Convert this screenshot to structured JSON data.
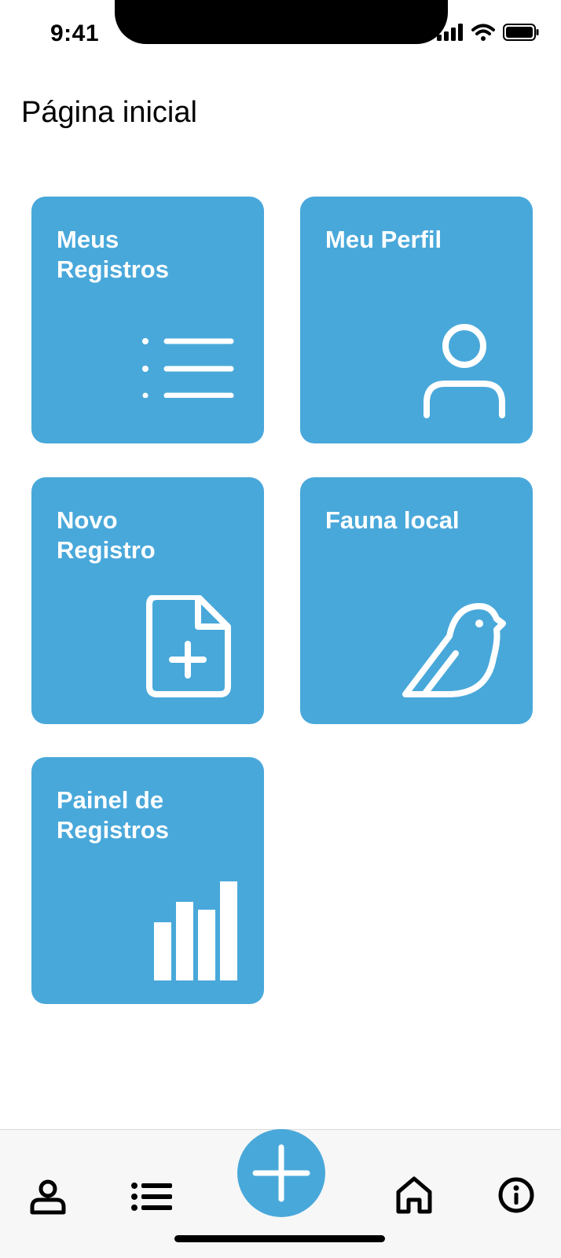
{
  "status_bar": {
    "time": "9:41"
  },
  "page": {
    "title": "Página inicial"
  },
  "tiles": [
    {
      "label": "Meus\nRegistros",
      "icon": "list-icon"
    },
    {
      "label": "Meu Perfil",
      "icon": "user-icon"
    },
    {
      "label": "Novo\nRegistro",
      "icon": "file-plus-icon"
    },
    {
      "label": "Fauna local",
      "icon": "bird-icon"
    },
    {
      "label": "Painel de\nRegistros",
      "icon": "bar-chart-icon"
    }
  ],
  "bottom_nav": {
    "items": [
      "profile-icon",
      "list-icon",
      "add-icon",
      "home-icon",
      "info-icon"
    ]
  },
  "colors": {
    "accent": "#49A8DA",
    "nav_bg": "#F7F7F7",
    "text": "#000000"
  }
}
